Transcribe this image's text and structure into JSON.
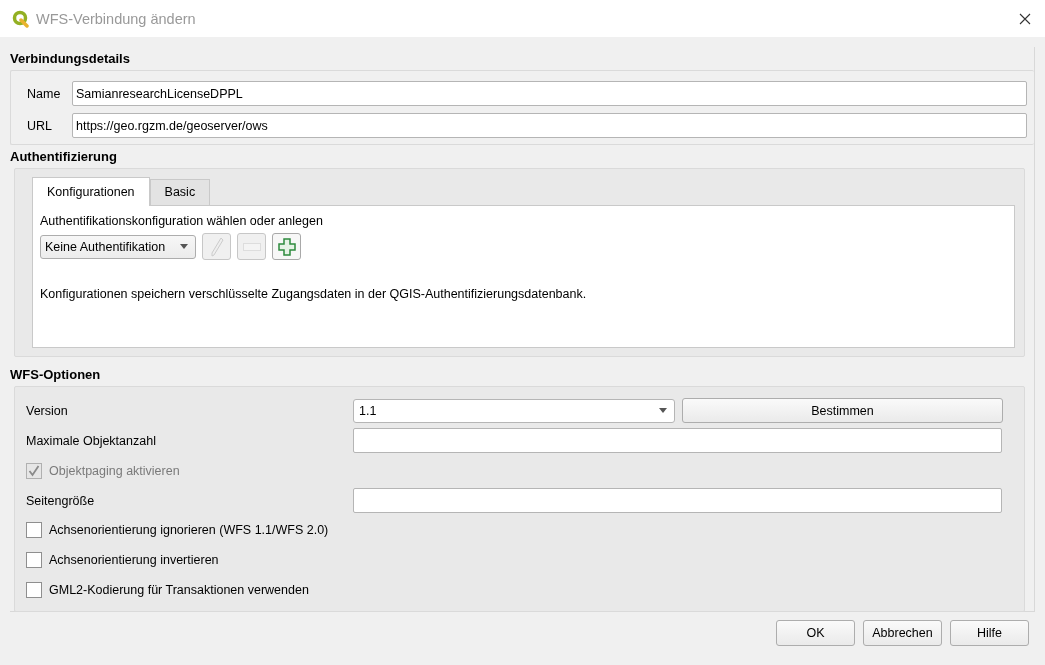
{
  "window": {
    "title": "WFS-Verbindung ändern"
  },
  "connection": {
    "heading": "Verbindungsdetails",
    "fields": [
      {
        "label": "Name",
        "value": "SamianresearchLicenseDPPL"
      },
      {
        "label": "URL",
        "value": "https://geo.rgzm.de/geoserver/ows"
      }
    ]
  },
  "authentication": {
    "heading": "Authentifizierung",
    "tabs": [
      {
        "label": "Konfigurationen",
        "selected": true
      },
      {
        "label": "Basic",
        "selected": false
      }
    ],
    "prompt": "Authentifikationskonfiguration wählen oder anlegen",
    "config": {
      "value": "Keine Authentifikation"
    },
    "tools": [
      {
        "kind": "edit",
        "disabled": true
      },
      {
        "kind": "remove",
        "disabled": true
      },
      {
        "kind": "add",
        "disabled": false
      }
    ],
    "note": "Konfigurationen speichern verschlüsselte Zugangsdaten in der QGIS-Authentifizierungsdatenbank."
  },
  "wfs_options": {
    "heading": "WFS-Optionen",
    "rows": [
      {
        "kind": "select",
        "label": "Version",
        "value": "1.1",
        "button": "Bestimmen"
      },
      {
        "kind": "input",
        "label": "Maximale Objektanzahl"
      },
      {
        "kind": "checkbox",
        "label": "Objektpaging aktivieren",
        "checked": true,
        "disabled": true
      },
      {
        "kind": "input",
        "label": "Seitengröße"
      },
      {
        "kind": "checkbox",
        "label": "Achsenorientierung ignorieren (WFS 1.1/WFS 2.0)",
        "checked": false,
        "disabled": false
      },
      {
        "kind": "checkbox",
        "label": "Achsenorientierung invertieren",
        "checked": false,
        "disabled": false
      },
      {
        "kind": "checkbox",
        "label": "GML2-Kodierung für Transaktionen verwenden",
        "checked": false,
        "disabled": false
      }
    ]
  },
  "buttons": [
    "OK",
    "Abbrechen",
    "Hilfe"
  ]
}
